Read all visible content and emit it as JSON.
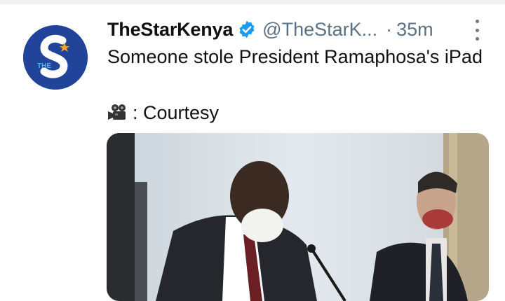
{
  "tweet": {
    "display_name": "TheStarKenya",
    "handle": "@TheStarK...",
    "separator": "·",
    "timestamp": "35m",
    "text": "Someone stole President Ramaphosa's iPad",
    "credit": ": Courtesy",
    "credit_icon": "movie-camera-icon",
    "verified": true,
    "avatar_text": "THE",
    "media": "video-thumbnail"
  },
  "colors": {
    "verified_blue": "#1d9bf0",
    "avatar_blue": "#22439a",
    "secondary_text": "#5b7083"
  }
}
